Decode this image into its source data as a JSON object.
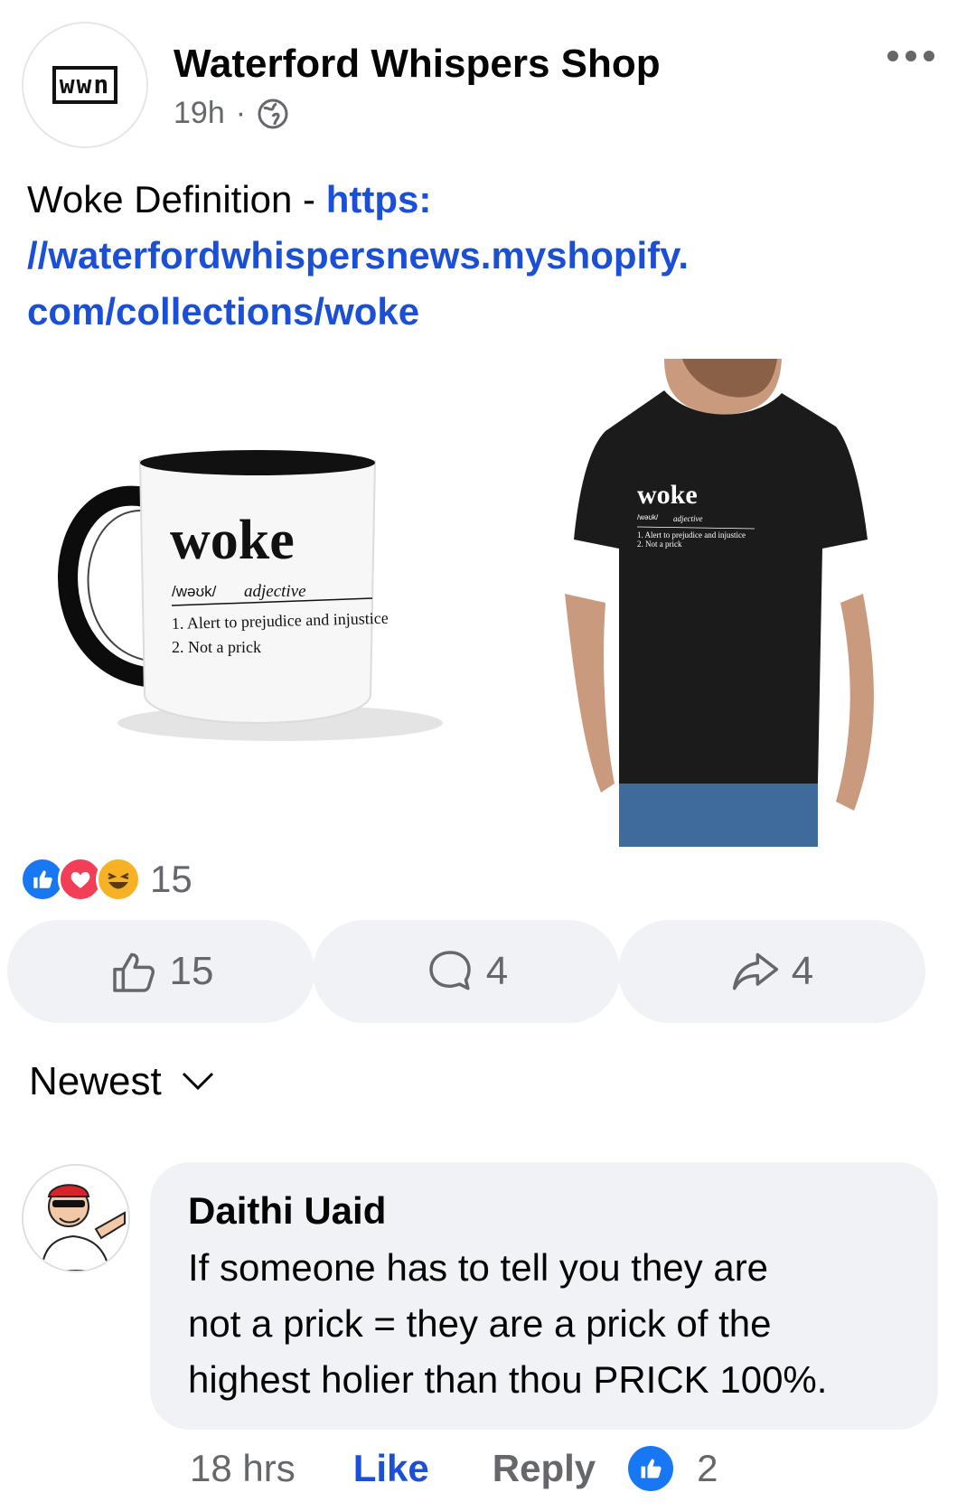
{
  "post": {
    "page_logo": "wwn",
    "page_name": "Waterford Whispers Shop",
    "time": "19h",
    "separator": "·",
    "text_prefix": "Woke Definition - ",
    "link": "https://waterfordwhispersnews.myshopify.com/collections/woke",
    "link_lines": [
      "https:",
      "//waterfordwhispersnews.myshopify.",
      "com/collections/woke"
    ]
  },
  "mug": {
    "word": "woke",
    "phonetic": "/wəʊk/",
    "pos": "adjective",
    "def1": "1. Alert to prejudice and injustice",
    "def2": "2. Not a prick"
  },
  "shirt": {
    "word": "woke",
    "phonetic": "/wəʊk/",
    "pos": "adjective",
    "def1": "1. Alert to prejudice and injustice",
    "def2": "2. Not a prick"
  },
  "reactions": {
    "count": "15",
    "icons": [
      "like-icon",
      "love-icon",
      "haha-icon"
    ]
  },
  "actions": {
    "like_count": "15",
    "comment_count": "4",
    "share_count": "4"
  },
  "sort": {
    "label": "Newest"
  },
  "comment": {
    "author": "Daithi Uaid",
    "text_lines": [
      "If someone has to tell you they are",
      "not a prick = they are a prick of the",
      "highest holier than thou PRICK 100%."
    ],
    "time": "18 hrs",
    "like_label": "Like",
    "reply_label": "Reply",
    "like_count": "2"
  },
  "colors": {
    "link": "#1b4fd6",
    "fb_blue": "#1877f2",
    "button_bg": "#f0f2f5",
    "muted": "#65676b"
  }
}
